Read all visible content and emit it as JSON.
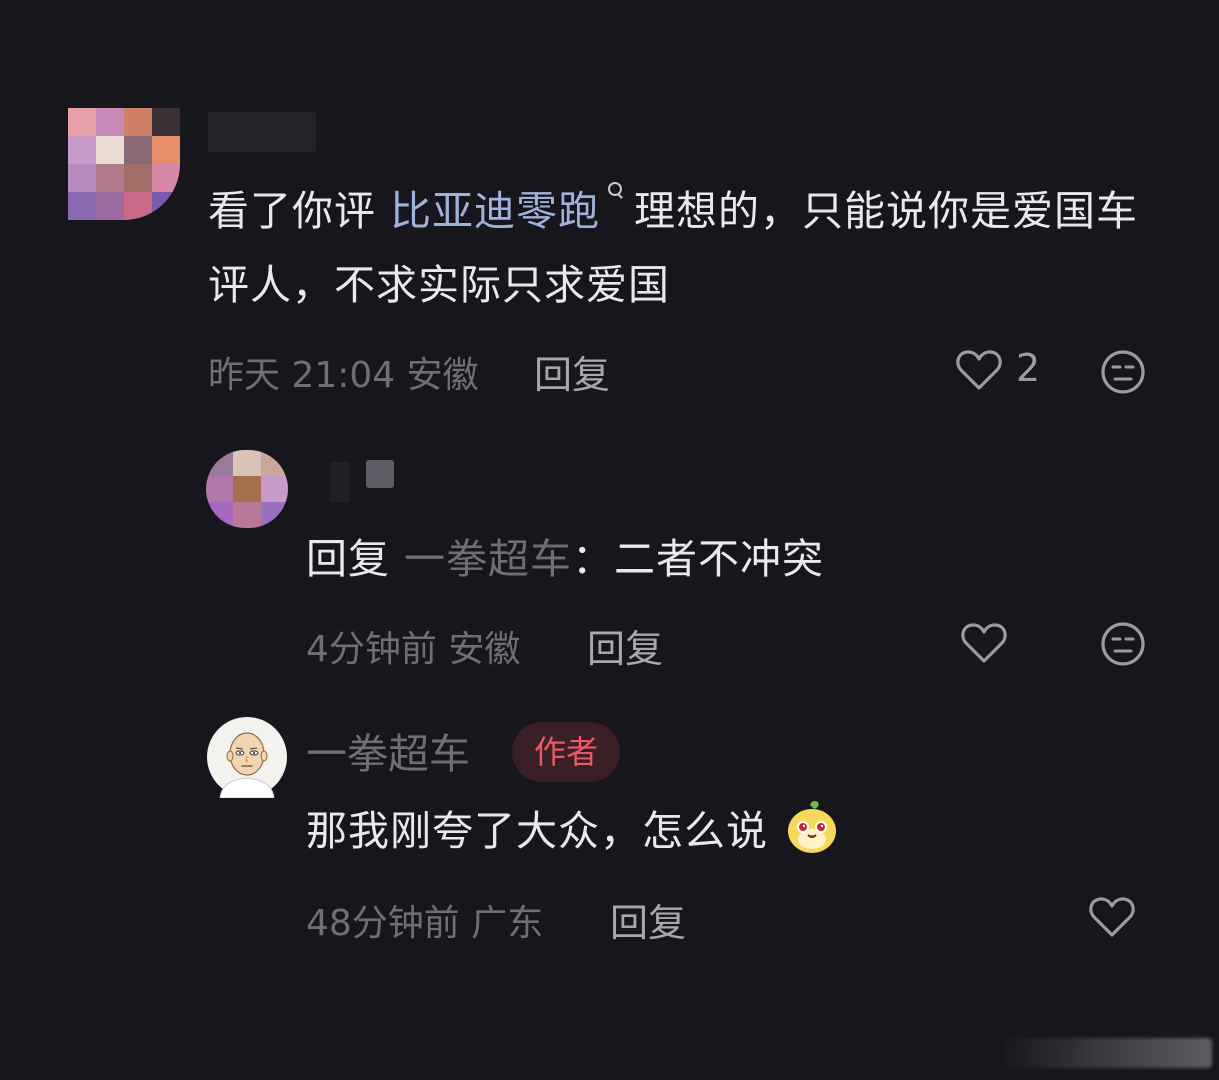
{
  "comments": [
    {
      "text_before": "看了你评 ",
      "link_text": "比亚迪零跑",
      "text_after": "理想的，只能说你是爱国车评人，不求实际只求爱国",
      "time": "昨天 21:04",
      "location": "安徽",
      "reply_label": "回复",
      "like_count": "2"
    },
    {
      "reply_prefix": "回复",
      "reply_to": "一拳超车",
      "text": "：二者不冲突",
      "time": "4分钟前",
      "location": "安徽",
      "reply_label": "回复"
    },
    {
      "author": "一拳超车",
      "badge": "作者",
      "text": "那我刚夸了大众，怎么说",
      "time": "48分钟前",
      "location": "广东",
      "reply_label": "回复"
    }
  ],
  "icons": {
    "like": "heart-outline-icon",
    "dislike": "meh-face-icon",
    "search": "search-icon",
    "emoji": "chick-sticker-emoji"
  },
  "colors": {
    "background": "#17161d",
    "link": "#9fb2d9",
    "badge_text": "#e85a66",
    "badge_bg": "#3a1f26"
  }
}
